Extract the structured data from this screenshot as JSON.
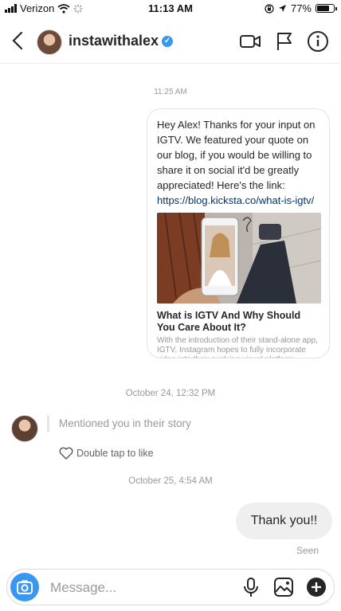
{
  "status_bar": {
    "carrier": "Verizon",
    "time": "11:13 AM",
    "battery_percent": "77%",
    "battery_level": 0.77,
    "icons": [
      "signal-icon",
      "wifi-icon",
      "activity-icon",
      "orientation-lock-icon",
      "location-icon",
      "battery-icon"
    ]
  },
  "header": {
    "username": "instawithalex",
    "verified": true,
    "icons": [
      "back-icon",
      "video-call-icon",
      "flag-icon",
      "info-icon"
    ]
  },
  "thread": {
    "timestamp_1": "11:25 AM",
    "shared_post": {
      "message_text": "Hey Alex! Thanks for your input on IGTV. We featured your quote on our blog, if you would be willing to share it on social it'd be greatly appreciated! Here's the link: ",
      "link_text": "https://­blog.kicksta.co/what-is-igtv/",
      "preview_title": "What is IGTV And Why Should You Care About It?",
      "preview_description": "With the introduction of their stand-alone app, IGTV, Instagram hopes to fully incorporate video into their evolving visual platform. Find..."
    },
    "timestamp_2": "October 24, 12:32 PM",
    "story_mention": {
      "text": "Mentioned you in their story",
      "like_hint": "Double tap to like"
    },
    "timestamp_3": "October 25, 4:54 AM",
    "reply": {
      "text": "Thank you!!",
      "status": "Seen"
    }
  },
  "composer": {
    "placeholder": "Message...",
    "icons": [
      "camera-icon",
      "microphone-icon",
      "gallery-icon",
      "add-icon"
    ]
  },
  "colors": {
    "accent": "#3897f0",
    "link": "#00376b",
    "bubble_gray": "#efefef",
    "muted_text": "#999999"
  }
}
